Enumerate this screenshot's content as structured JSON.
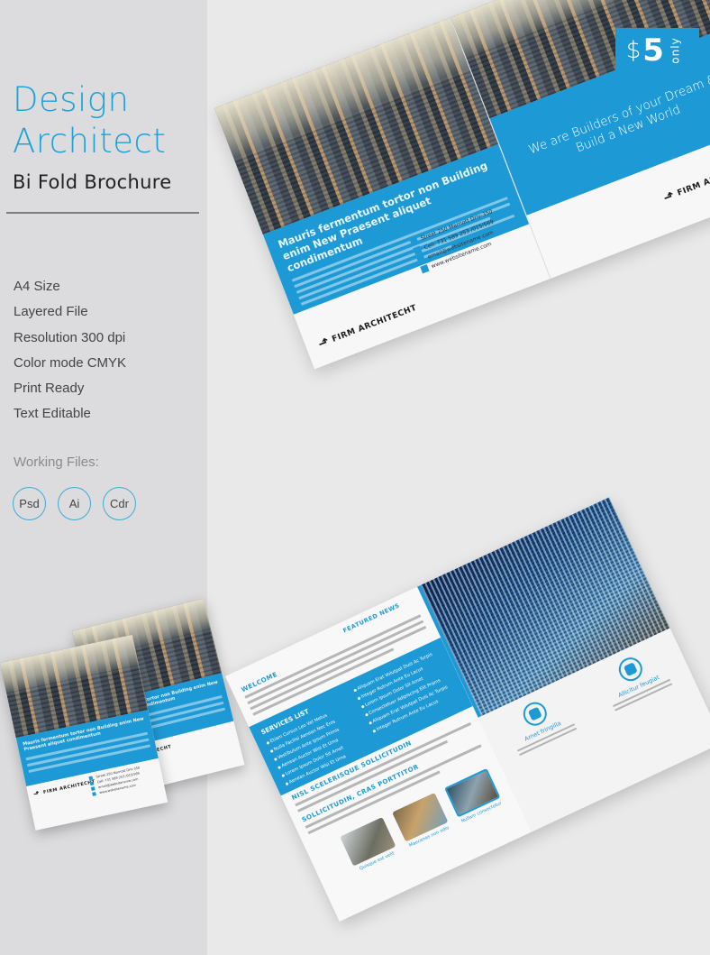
{
  "side_panel": {
    "title_line1": "Design",
    "title_line2": "Architect",
    "subtitle": "Bi Fold Brochure",
    "features": [
      "A4 Size",
      "Layered File",
      "Resolution 300 dpi",
      "Color mode CMYK",
      "Print Ready",
      "Text Editable"
    ],
    "working_files_label": "Working Files:",
    "file_badges": [
      "Psd",
      "Ai",
      "Cdr"
    ]
  },
  "price_tag": {
    "currency": "$",
    "amount": "5",
    "suffix": "only"
  },
  "cover": {
    "headline": "Mauris fermentum tortor non Building enim New Praesent aliquet condimentum",
    "tagline": "We are Builders of your Dream & Build a New World",
    "logo_text": "FIRM ARCHITECHT",
    "contacts": [
      {
        "icon": "location-icon",
        "text": "Street 250 Marriott Driv-350"
      },
      {
        "icon": "phone-icon",
        "text": "Cell: 731 589 253 /015/569"
      },
      {
        "icon": "email-icon",
        "text": "email@websitename.com"
      },
      {
        "icon": "web-icon",
        "text": "www.websitename.com"
      }
    ]
  },
  "inside": {
    "welcome_title": "WELCOME",
    "services_title": "SERVICES LIST",
    "services_col1": [
      "Etiam Cursus Leo Vel Metus",
      "Nulla Facilisi Aenean Nec Eros",
      "Vestibulum Ante Ipsum Primis",
      "Aenean Auctor Wisi Et Urna",
      "Lorem Ipsum Dolor Sit Amet",
      "Aenean Auctor Wisi Et Urna"
    ],
    "services_col2": [
      "Aliquam Erat Volutpat Duis Ac Turpis",
      "Integer Rutrum Ante Eu Lacus",
      "Lorem Ipsum Dolor Sit Amet",
      "Consectetuer Adipiscing Elit Prams",
      "Aliquam Erat Volutpat Duis Ac Turpis",
      "Integer Rutrum Ante Eu Lacus"
    ],
    "section2_title": "NISL SCELERISQUE SOLLICITUDIN",
    "section3_title": "SOLLICITUDIN, CRAS PORTTITOR",
    "featured_news_title": "FEATURED NEWS",
    "thumbnails": [
      {
        "caption": "Quisque est velit"
      },
      {
        "caption": "Maecenas non odio"
      },
      {
        "caption": "Nullam consectetur"
      }
    ],
    "feature_items": [
      {
        "name": "Amet fringilla"
      },
      {
        "name": "Allicitur feugiat"
      }
    ]
  },
  "colors": {
    "accent": "#1d9ad6",
    "title_blue": "#1aa3d9",
    "side_panel_bg": "#dcdbdd",
    "page_bg": "#e9e9ea"
  }
}
